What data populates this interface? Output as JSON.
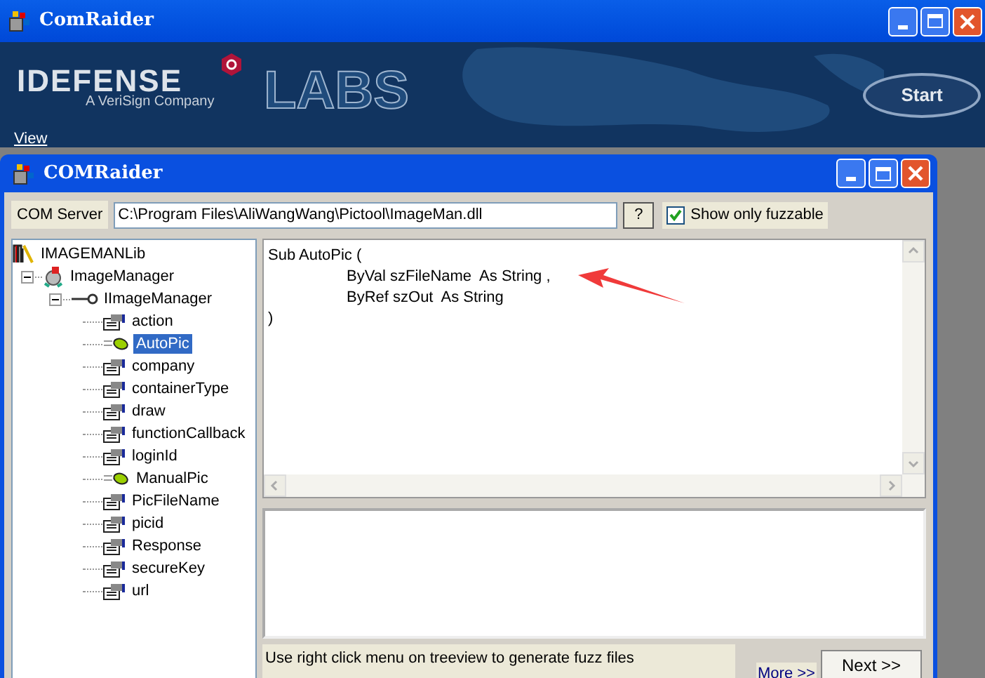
{
  "outer_window": {
    "title": "ComRaider"
  },
  "banner": {
    "logo": "IDEFENSE",
    "tagline": "A VeriSign Company",
    "labs": "LABS",
    "start_button": "Start",
    "menu": [
      "View"
    ]
  },
  "inner_window": {
    "title": "COMRaider"
  },
  "com_server": {
    "label": "COM Server",
    "value": "C:\\Program Files\\AliWangWang\\Pictool\\ImageMan.dll",
    "help_button": "?",
    "fuzzable_checkbox": {
      "label": "Show only fuzzable",
      "checked": true
    }
  },
  "tree": [
    {
      "label": "IMAGEMANLib",
      "kind": "library",
      "selected": false,
      "children": [
        {
          "label": "ImageManager",
          "kind": "class",
          "selected": false,
          "expanded": true,
          "children": [
            {
              "label": "IImageManager",
              "kind": "interface",
              "selected": false,
              "expanded": true,
              "children": [
                {
                  "label": "action",
                  "kind": "property",
                  "selected": false
                },
                {
                  "label": "AutoPic",
                  "kind": "method",
                  "selected": true
                },
                {
                  "label": "company",
                  "kind": "property",
                  "selected": false
                },
                {
                  "label": "containerType",
                  "kind": "property",
                  "selected": false
                },
                {
                  "label": "draw",
                  "kind": "property",
                  "selected": false
                },
                {
                  "label": "functionCallback",
                  "kind": "property",
                  "selected": false
                },
                {
                  "label": "loginId",
                  "kind": "property",
                  "selected": false
                },
                {
                  "label": "ManualPic",
                  "kind": "method",
                  "selected": false
                },
                {
                  "label": "PicFileName",
                  "kind": "property",
                  "selected": false
                },
                {
                  "label": "picid",
                  "kind": "property",
                  "selected": false
                },
                {
                  "label": "Response",
                  "kind": "property",
                  "selected": false
                },
                {
                  "label": "secureKey",
                  "kind": "property",
                  "selected": false
                },
                {
                  "label": "url",
                  "kind": "property",
                  "selected": false
                }
              ]
            }
          ]
        }
      ]
    }
  ],
  "code_lines": [
    {
      "text": "Sub AutoPic (",
      "indented": false
    },
    {
      "text": "ByVal szFileName  As String ,",
      "indented": true
    },
    {
      "text": "ByRef szOut  As String",
      "indented": true
    },
    {
      "text": ")",
      "indented": false
    }
  ],
  "status_text": "Use right click menu on treeview to generate fuzz files",
  "more_link": "More >>",
  "next_button": "Next >>"
}
